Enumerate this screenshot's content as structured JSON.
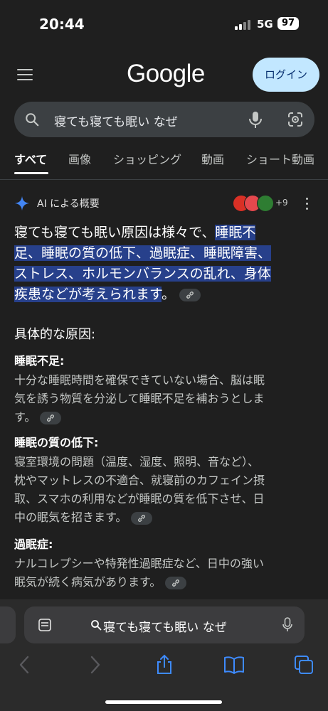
{
  "status": {
    "time": "20:44",
    "network": "5G",
    "battery": "97"
  },
  "header": {
    "logo": "Google",
    "login_label": "ログイン"
  },
  "search": {
    "query": "寝ても寝ても眠い なぜ"
  },
  "tabs": [
    {
      "label": "すべて"
    },
    {
      "label": "画像"
    },
    {
      "label": "ショッピング"
    },
    {
      "label": "動画"
    },
    {
      "label": "ショート動画"
    }
  ],
  "ai_overview": {
    "title": "AI による概要",
    "more_sources": "+9",
    "summary_plain": "寝ても寝ても眠い原因は様々で、",
    "summary_highlight_1": "睡眠不",
    "summary_highlight_2": "足、睡眠の質の低下、過眠症、睡眠障害、",
    "summary_highlight_3": "ストレス、ホルモンバランスの乱れ、身体",
    "summary_highlight_4": "疾患などが考えられます",
    "summary_end": "。"
  },
  "causes": {
    "section_title": "具体的な原因:",
    "items": [
      {
        "title": "睡眠不足:",
        "line1": "十分な睡眠時間を確保できていない場合、脳は眠",
        "line2": "気を誘う物質を分泌して睡眠不足を補おうとしま",
        "line3": "す。"
      },
      {
        "title": "睡眠の質の低下:",
        "line1": "寝室環境の問題（温度、湿度、照明、音など）、",
        "line2": "枕やマットレスの不適合、就寝前のカフェイン摂",
        "line3": "取、スマホの利用などが睡眠の質を低下させ、日",
        "line4": "中の眠気を招きます。"
      },
      {
        "title": "過眠症:",
        "line1": "ナルコレプシーや特発性過眠症など、日中の強い",
        "line2": "眠気が続く病気があります。"
      }
    ]
  },
  "browser": {
    "address_text": "寝ても寝ても眠い なぜ"
  },
  "colors": {
    "highlight": "#27408b",
    "login_bg": "#c2e7ff",
    "ai_spark": "#4285f4"
  }
}
